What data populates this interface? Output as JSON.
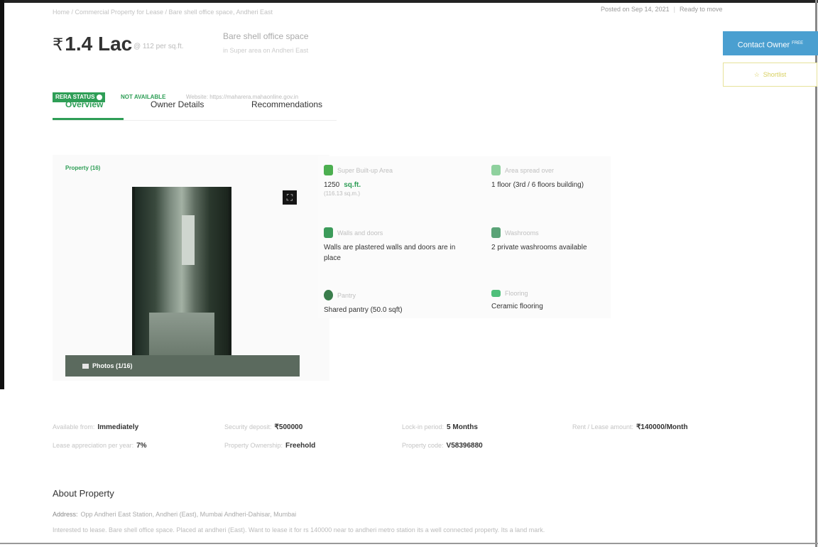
{
  "breadcrumb": "Home / Commercial Property for Lease / Bare shell office space, Andheri East",
  "posted": {
    "date": "Posted on Sep 14, 2021",
    "status": "Ready to move"
  },
  "header": {
    "price": "1.4 Lac",
    "currency_symbol": "₹",
    "per_sqft": "@ 112 per sq.ft.",
    "title": "Bare shell office space",
    "subtitle": "in Super area on Andheri East"
  },
  "rera": {
    "label": "RERA STATUS",
    "status": "NOT AVAILABLE",
    "website": "Website: https://maharera.mahaonline.gov.in"
  },
  "tabs": [
    {
      "label": "Overview",
      "active": true
    },
    {
      "label": "Owner Details",
      "active": false
    },
    {
      "label": "Recommendations",
      "active": false
    }
  ],
  "gallery": {
    "section_label": "Property (16)",
    "photos_label": "Photos (1/16)",
    "expand_icon": "expand-icon"
  },
  "features": [
    {
      "icon": "area-icon",
      "color": "#4caf50",
      "label": "Super Built-up Area",
      "value": "1250",
      "unit": "sq.ft.",
      "sub": "(116.13 sq.m.)"
    },
    {
      "icon": "floor-icon",
      "color": "#8fd19e",
      "label": "Area spread over",
      "value": "1 floor (3rd / 6 floors building)"
    },
    {
      "icon": "walls-icon",
      "color": "#3c9b5a",
      "label": "Walls and doors",
      "value": "Walls are plastered walls and doors are in place"
    },
    {
      "icon": "washroom-icon",
      "color": "#5aa377",
      "label": "Washrooms",
      "value": "2 private washrooms available"
    },
    {
      "icon": "pantry-icon",
      "color": "#3a7d4c",
      "label": "Pantry",
      "value": "Shared pantry (50.0 sqft)"
    },
    {
      "icon": "flooring-icon",
      "color": "#4fbf7a",
      "label": "Flooring",
      "value": "Ceramic flooring"
    }
  ],
  "actions": {
    "contact_label": "Contact Owner",
    "contact_badge": "FREE",
    "shortlist_label": "Shortlist",
    "contact_color": "#4a9fd0"
  },
  "details": [
    {
      "label": "Available from:",
      "value": "Immediately"
    },
    {
      "label": "Security deposit:",
      "value": "₹500000"
    },
    {
      "label": "Lock-in period:",
      "value": "5 Months"
    },
    {
      "label": "Rent / Lease amount:",
      "value": "₹140000/Month"
    },
    {
      "label": "Lease appreciation per year:",
      "value": "7%"
    },
    {
      "label": "Property Ownership:",
      "value": "Freehold"
    },
    {
      "label": "Property code:",
      "value": "V58396880"
    }
  ],
  "about": {
    "title": "About Property",
    "address_label": "Address:",
    "address": "Opp Andheri East Station, Andheri (East), Mumbai Andheri-Dahisar, Mumbai",
    "description": "Interested to lease. Bare shell office space. Placed at andheri (East). Want to lease it for rs 140000 near to andheri metro station its a well connected property. Its a land mark."
  },
  "theme": {
    "accent": "#2e9e56"
  }
}
